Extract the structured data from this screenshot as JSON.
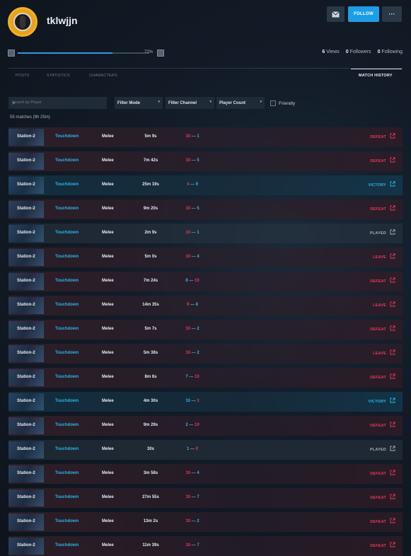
{
  "profile": {
    "username": "tklwjjn",
    "follow_label": "FOLLOW",
    "more_label": "···",
    "progress_fraction": 0.72,
    "progress_label": "72%"
  },
  "stats": {
    "views_count": "6",
    "views_label": "Views",
    "followers_count": "0",
    "followers_label": "Followers",
    "following_count": "0",
    "following_label": "Following"
  },
  "tabs": [
    "POSTS",
    "STATISTICS",
    "CHARACTERS",
    "MATCH HISTORY"
  ],
  "filters": {
    "search_placeholder": "Search by Player",
    "mode": "Filter Mode",
    "channel": "Filter Channel",
    "player_count": "Player Count",
    "friendly": "Friendly"
  },
  "match_count": "55 matches (9h 25m)",
  "colors": {
    "accent": "#1d9ee8",
    "red_team": "#ea3558",
    "blue_team": "#2ab3ea"
  },
  "matches": [
    {
      "map": "Station-2",
      "mode": "Touchdown",
      "type": "Melee",
      "duration": "5m 9s",
      "first": "10",
      "first_team": "red",
      "second": "1",
      "second_team": "blue",
      "result": "DEFEAT",
      "result_class": "defeat"
    },
    {
      "map": "Station-2",
      "mode": "Touchdown",
      "type": "Melee",
      "duration": "7m 42s",
      "first": "10",
      "first_team": "red",
      "second": "5",
      "second_team": "blue",
      "result": "DEFEAT",
      "result_class": "defeat"
    },
    {
      "map": "Station-2",
      "mode": "Touchdown",
      "type": "Melee",
      "duration": "25m 19s",
      "first": "4",
      "first_team": "red",
      "second": "9",
      "second_team": "blue",
      "result": "VICTORY",
      "result_class": "victory"
    },
    {
      "map": "Station-2",
      "mode": "Touchdown",
      "type": "Melee",
      "duration": "9m 20s",
      "first": "10",
      "first_team": "red",
      "second": "5",
      "second_team": "blue",
      "result": "DEFEAT",
      "result_class": "defeat"
    },
    {
      "map": "Station-2",
      "mode": "Touchdown",
      "type": "Melee",
      "duration": "2m 9s",
      "first": "10",
      "first_team": "red",
      "second": "1",
      "second_team": "blue",
      "result": "PLAYED",
      "result_class": "played"
    },
    {
      "map": "Station-2",
      "mode": "Touchdown",
      "type": "Melee",
      "duration": "5m 0s",
      "first": "10",
      "first_team": "red",
      "second": "4",
      "second_team": "blue",
      "result": "LEAVE",
      "result_class": "leave"
    },
    {
      "map": "Station-2",
      "mode": "Touchdown",
      "type": "Melee",
      "duration": "7m 24s",
      "first": "8",
      "first_team": "blue",
      "second": "10",
      "second_team": "red",
      "result": "DEFEAT",
      "result_class": "defeat"
    },
    {
      "map": "Station-2",
      "mode": "Touchdown",
      "type": "Melee",
      "duration": "14m 35s",
      "first": "9",
      "first_team": "red",
      "second": "8",
      "second_team": "blue",
      "result": "LEAVE",
      "result_class": "leave"
    },
    {
      "map": "Station-2",
      "mode": "Touchdown",
      "type": "Melee",
      "duration": "5m 7s",
      "first": "10",
      "first_team": "red",
      "second": "2",
      "second_team": "blue",
      "result": "DEFEAT",
      "result_class": "defeat"
    },
    {
      "map": "Station-2",
      "mode": "Touchdown",
      "type": "Melee",
      "duration": "5m 38s",
      "first": "10",
      "first_team": "red",
      "second": "2",
      "second_team": "blue",
      "result": "LEAVE",
      "result_class": "leave"
    },
    {
      "map": "Station-2",
      "mode": "Touchdown",
      "type": "Melee",
      "duration": "8m 6s",
      "first": "7",
      "first_team": "blue",
      "second": "10",
      "second_team": "red",
      "result": "DEFEAT",
      "result_class": "defeat"
    },
    {
      "map": "Station-2",
      "mode": "Touchdown",
      "type": "Melee",
      "duration": "4m 30s",
      "first": "10",
      "first_team": "blue",
      "second": "3",
      "second_team": "red",
      "result": "VICTORY",
      "result_class": "victory"
    },
    {
      "map": "Station-2",
      "mode": "Touchdown",
      "type": "Melee",
      "duration": "9m 29s",
      "first": "2",
      "first_team": "blue",
      "second": "10",
      "second_team": "red",
      "result": "DEFEAT",
      "result_class": "defeat"
    },
    {
      "map": "Station-2",
      "mode": "Touchdown",
      "type": "Melee",
      "duration": "30s",
      "first": "1",
      "first_team": "blue",
      "second": "0",
      "second_team": "red",
      "result": "PLAYED",
      "result_class": "played"
    },
    {
      "map": "Station-2",
      "mode": "Touchdown",
      "type": "Melee",
      "duration": "3m 58s",
      "first": "10",
      "first_team": "red",
      "second": "4",
      "second_team": "blue",
      "result": "DEFEAT",
      "result_class": "defeat"
    },
    {
      "map": "Station-2",
      "mode": "Touchdown",
      "type": "Melee",
      "duration": "27m 55s",
      "first": "10",
      "first_team": "red",
      "second": "7",
      "second_team": "blue",
      "result": "DEFEAT",
      "result_class": "defeat"
    },
    {
      "map": "Station-2",
      "mode": "Touchdown",
      "type": "Melee",
      "duration": "13m 2s",
      "first": "10",
      "first_team": "red",
      "second": "2",
      "second_team": "blue",
      "result": "DEFEAT",
      "result_class": "defeat"
    },
    {
      "map": "Station-2",
      "mode": "Touchdown",
      "type": "Melee",
      "duration": "11m 39s",
      "first": "10",
      "first_team": "red",
      "second": "7",
      "second_team": "blue",
      "result": "DEFEAT",
      "result_class": "defeat"
    }
  ]
}
